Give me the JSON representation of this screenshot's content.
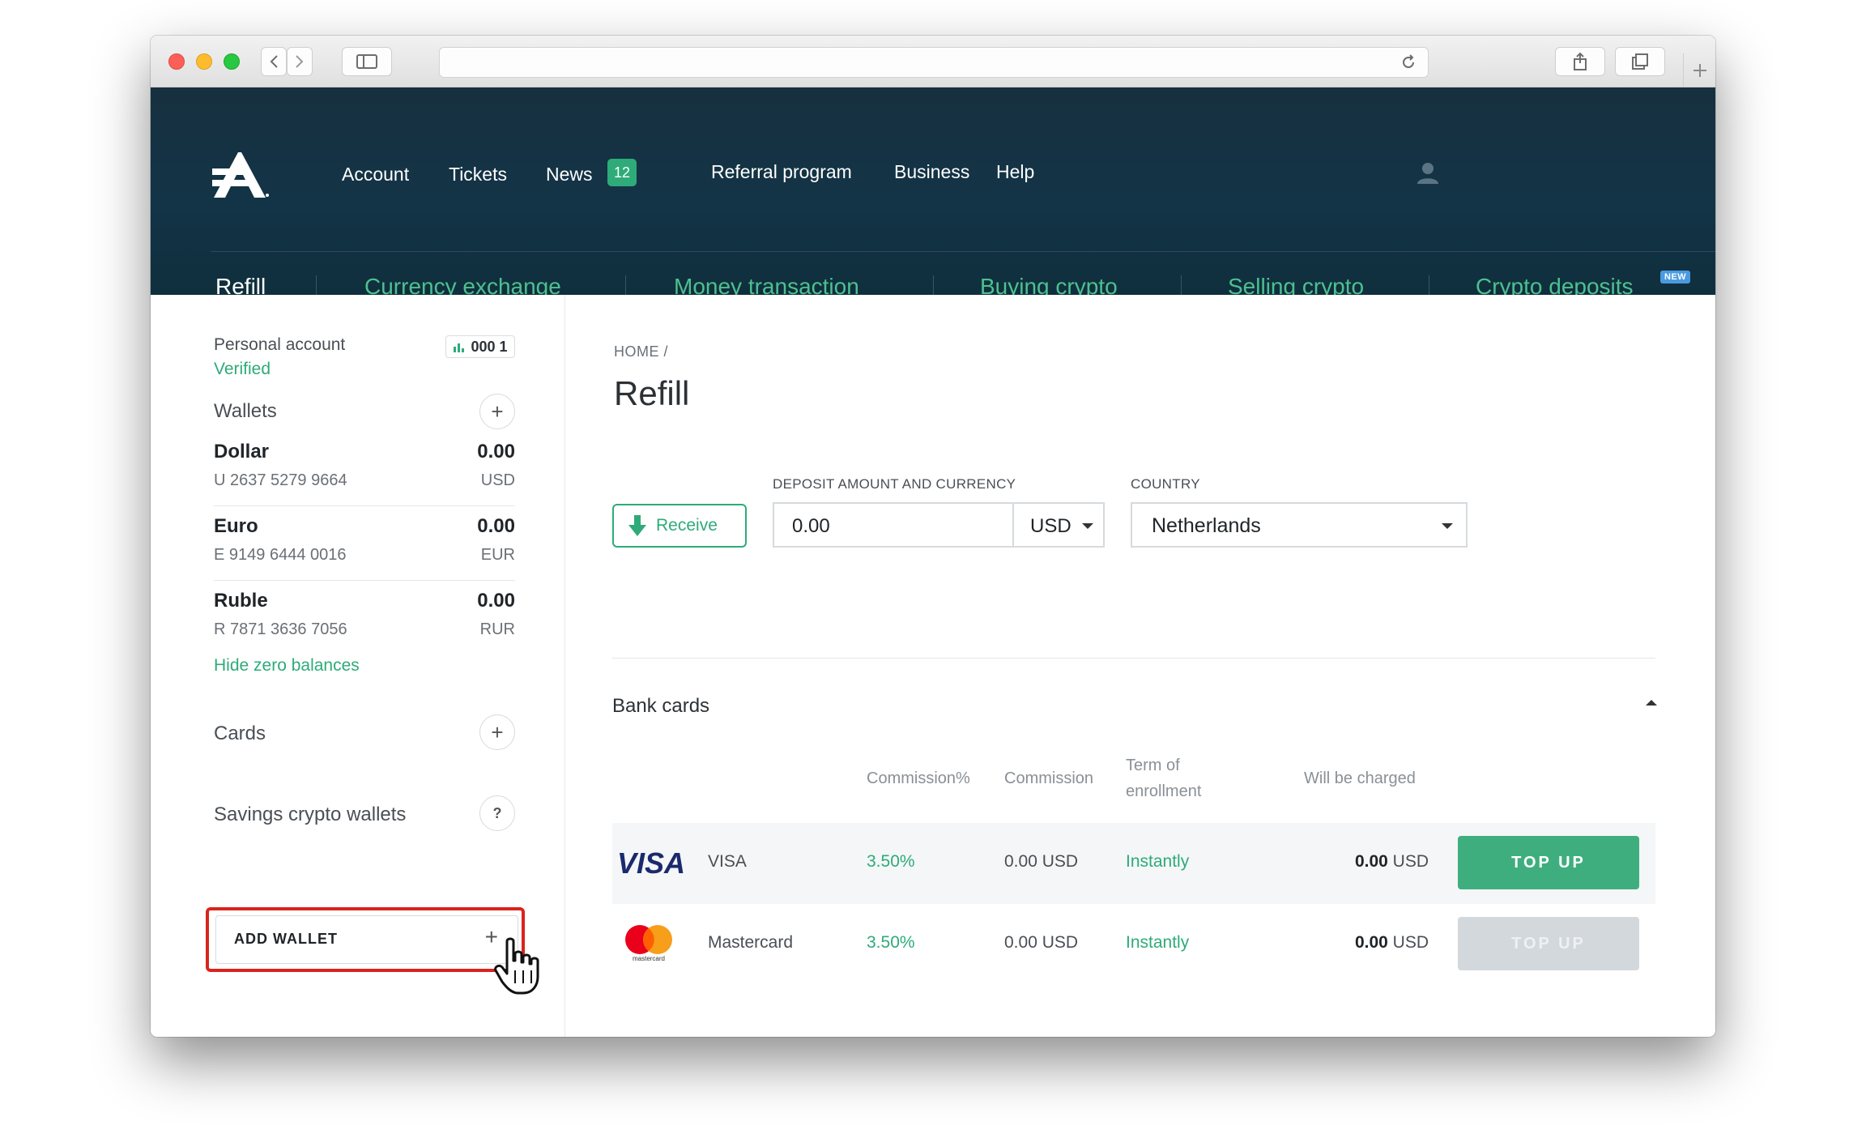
{
  "header": {
    "nav": [
      "Account",
      "Tickets",
      "News"
    ],
    "news_badge": "12",
    "nav2": [
      "Referral program",
      "Business",
      "Help"
    ],
    "tabs": [
      "Refill",
      "Currency exchange",
      "Money transaction",
      "Buying crypto",
      "Selling crypto",
      "Crypto deposits"
    ],
    "new_badge": "NEW"
  },
  "sidebar": {
    "account_label": "Personal account",
    "account_status": "Verified",
    "account_chip": "000 1",
    "wallets_title": "Wallets",
    "wallets": [
      {
        "name": "Dollar",
        "amount": "0.00",
        "account": "U 2637 5279 9664",
        "currency": "USD"
      },
      {
        "name": "Euro",
        "amount": "0.00",
        "account": "E 9149 6444 0016",
        "currency": "EUR"
      },
      {
        "name": "Ruble",
        "amount": "0.00",
        "account": "R 7871 3636 7056",
        "currency": "RUR"
      }
    ],
    "hide_zero": "Hide zero balances",
    "cards_title": "Cards",
    "savings_title": "Savings crypto wallets",
    "savings_help": "?",
    "add_wallet": "ADD WALLET",
    "plus": "+"
  },
  "main": {
    "breadcrumb": "HOME /",
    "title": "Refill",
    "receive_label": "Receive",
    "deposit_label": "DEPOSIT AMOUNT AND CURRENCY",
    "amount_value": "0.00",
    "currency_value": "USD",
    "country_label": "COUNTRY",
    "country_value": "Netherlands",
    "bank_cards_title": "Bank cards",
    "columns": {
      "commission_pct": "Commission%",
      "commission": "Commission",
      "term_line1": "Term of",
      "term_line2": "enrollment",
      "charged": "Will be charged"
    },
    "cards": [
      {
        "logo": "VISA",
        "name": "VISA",
        "pct": "3.50%",
        "commission": "0.00 USD",
        "term": "Instantly",
        "charged_amount": "0.00",
        "charged_currency": "USD",
        "button": "TOP UP"
      },
      {
        "logo": "mastercard",
        "name": "Mastercard",
        "pct": "3.50%",
        "commission": "0.00 USD",
        "term": "Instantly",
        "charged_amount": "0.00",
        "charged_currency": "USD",
        "button": "TOP UP"
      }
    ]
  },
  "colors": {
    "header_bg": "#133447",
    "accent_green": "#2eab79",
    "highlight_red": "#d9241d",
    "new_badge": "#4a9ae0"
  },
  "icons": [
    "back-icon",
    "forward-icon",
    "sidebar-icon",
    "reload-icon",
    "share-icon",
    "tabs-icon",
    "user-icon",
    "download-arrow-icon",
    "hand-cursor-icon"
  ]
}
